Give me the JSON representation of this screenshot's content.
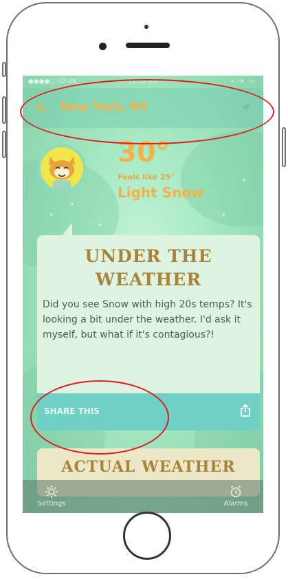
{
  "status_bar": {
    "carrier": "●●●●○ O2-UK",
    "time": "12:38 AM",
    "right": "⌁ ✈ ▭"
  },
  "search": {
    "location": "New York, NY",
    "icon": "search-icon",
    "arrow_icon": "location-arrow-icon"
  },
  "weather": {
    "temperature": "30°",
    "feels_like": "Feels like 25°",
    "condition": "Light Snow"
  },
  "card": {
    "headline_line1": "UNDER THE",
    "headline_line2": "WEATHER",
    "body": "Did you see Snow with high 20s temps? It's looking a bit under the weather. I'd ask it myself, but what if it's contagious?!",
    "share_label": "SHARE THIS",
    "share_icon": "share-icon"
  },
  "card2": {
    "title": "ACTUAL WEATHER"
  },
  "tabs": [
    {
      "label": "Settings",
      "icon": "gear-icon"
    },
    {
      "label": "Alarms",
      "icon": "alarm-clock-icon"
    }
  ],
  "colors": {
    "accent": "#f4b14c",
    "headline": "#a8843b",
    "share_bar": "#6fd0c6",
    "annotation": "#e21b1b"
  }
}
